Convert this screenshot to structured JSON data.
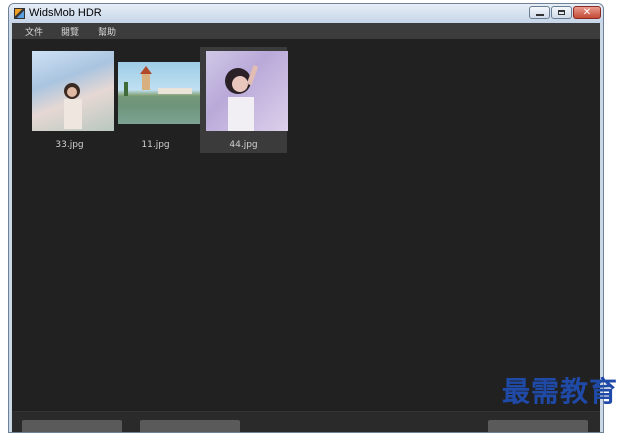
{
  "window": {
    "title": "WidsMob HDR"
  },
  "titlebar": {
    "minimize_icon": "minimize-icon",
    "maximize_icon": "maximize-icon",
    "close_icon": "close-icon",
    "close_glyph": "✕"
  },
  "menu": {
    "items": [
      "文件",
      "閱覽",
      "幫助"
    ]
  },
  "thumbnails": [
    {
      "filename": "33.jpg",
      "selected": false
    },
    {
      "filename": "11.jpg",
      "selected": false
    },
    {
      "filename": "44.jpg",
      "selected": true
    }
  ],
  "watermark": {
    "text": "最需教育"
  },
  "colors": {
    "content_bg": "#212121",
    "menubar_bg": "#3c3c3c",
    "watermark": "#1f4aa8"
  }
}
